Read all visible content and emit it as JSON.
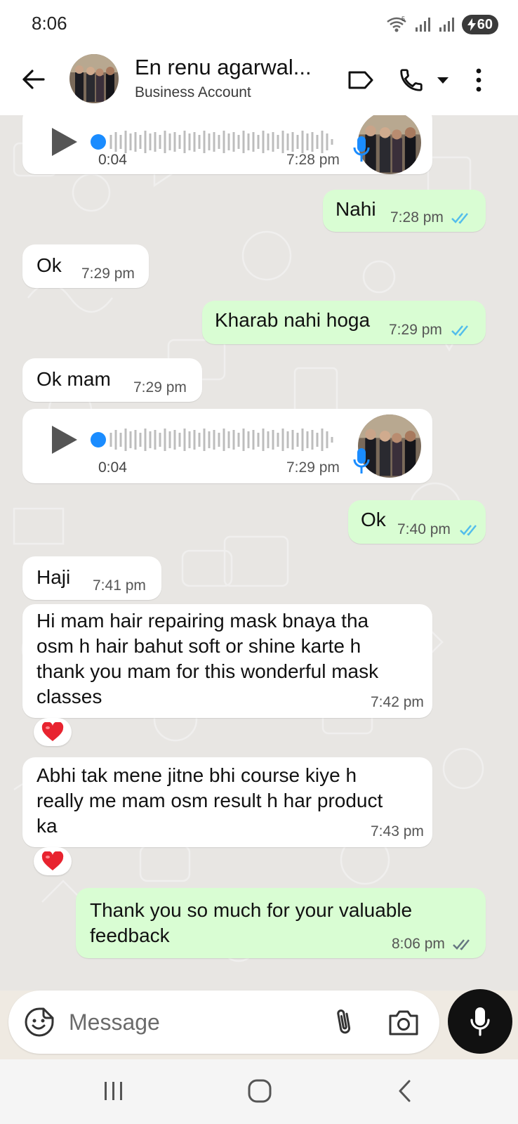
{
  "status_bar": {
    "time": "8:06",
    "battery": "60",
    "wifi_badge": "5"
  },
  "header": {
    "contact_name": "En renu agarwal...",
    "subtitle": "Business Account",
    "icons": [
      "back-arrow-icon",
      "label-icon",
      "phone-icon",
      "dropdown-icon",
      "more-vert-icon"
    ]
  },
  "messages": [
    {
      "type": "voice",
      "direction": "in",
      "duration": "0:04",
      "time": "7:28 pm"
    },
    {
      "type": "text",
      "direction": "out",
      "text": "Nahi",
      "time": "7:28 pm",
      "status": "read"
    },
    {
      "type": "text",
      "direction": "in",
      "text": "Ok",
      "time": "7:29 pm"
    },
    {
      "type": "text",
      "direction": "out",
      "text": "Kharab nahi hoga",
      "time": "7:29 pm",
      "status": "read"
    },
    {
      "type": "text",
      "direction": "in",
      "text": "Ok mam",
      "time": "7:29 pm"
    },
    {
      "type": "voice",
      "direction": "in",
      "duration": "0:04",
      "time": "7:29 pm"
    },
    {
      "type": "text",
      "direction": "out",
      "text": "Ok",
      "time": "7:40 pm",
      "status": "read"
    },
    {
      "type": "text",
      "direction": "in",
      "text": "Haji",
      "time": "7:41 pm"
    },
    {
      "type": "text",
      "direction": "in",
      "lines": [
        "Hi mam hair repairing mask bnaya tha",
        "osm h hair bahut soft or shine karte h",
        "thank you mam for this wonderful mask",
        "classes"
      ],
      "time": "7:42 pm",
      "reaction": "❤️"
    },
    {
      "type": "text",
      "direction": "in",
      "lines": [
        "Abhi tak mene jitne bhi course kiye h",
        "really me mam osm result h har product",
        "ka"
      ],
      "time": "7:43 pm",
      "reaction": "❤️"
    },
    {
      "type": "text",
      "direction": "out",
      "lines": [
        "Thank you so much for your valuable",
        "feedback"
      ],
      "time": "8:06 pm",
      "status": "delivered"
    }
  ],
  "input": {
    "placeholder": "Message"
  },
  "colors": {
    "incoming_bubble": "#ffffff",
    "outgoing_bubble": "#d9fdd3",
    "read_tick": "#53bdeb",
    "delivered_tick": "#667781",
    "chat_background": "#e8e6e3",
    "voice_dot": "#1a8cff"
  }
}
